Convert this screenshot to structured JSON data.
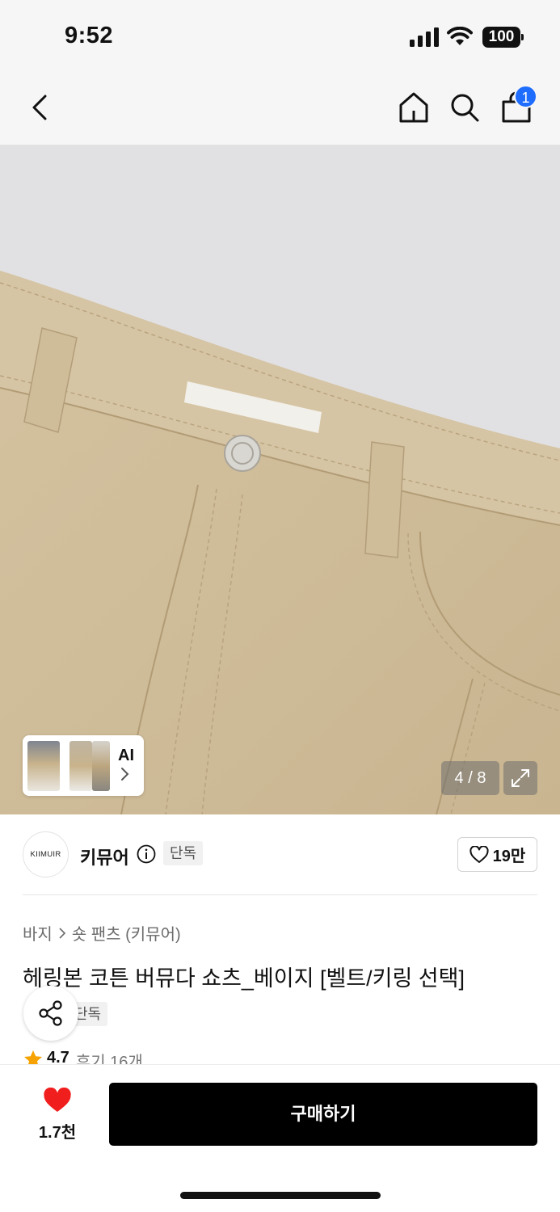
{
  "status_bar": {
    "time": "9:52",
    "battery": "100"
  },
  "nav": {
    "cart_count": "1",
    "icons": [
      "chevron-left-icon",
      "home-icon",
      "search-icon",
      "shopping-bag-icon"
    ]
  },
  "gallery": {
    "counter": "4 / 8",
    "ai_label": "AI"
  },
  "brand": {
    "logo_text": "KIIMUIR",
    "name": "키뮤어",
    "exclusive_tag": "단독",
    "like_count": "19만"
  },
  "product": {
    "breadcrumb": [
      "바지",
      "숏 팬츠 (키뮤어)"
    ],
    "title": "헤링본 코튼 버뮤다 쇼츠_베이지 [벨트/키링 선택]",
    "tag": "단독",
    "rating": "4.7",
    "reviews": "후기 16개"
  },
  "bottom_bar": {
    "wish_count": "1.7천",
    "buy_label": "구매하기"
  },
  "colors": {
    "accent_badge": "#1f6dff",
    "heart": "#f11e1e",
    "star": "#f6a200",
    "fabric": "#d2bf9d"
  }
}
